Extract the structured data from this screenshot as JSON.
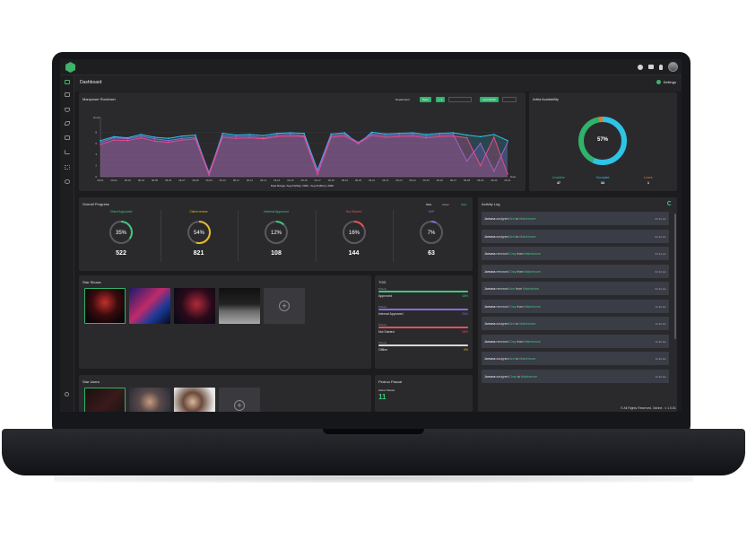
{
  "app": {
    "page_title": "Dashboard",
    "settings_label": "Settings",
    "footer": "© All Rights Reserved. 3dvine - v 1.0.81"
  },
  "icons": {
    "logo": "cube-logo-icon",
    "top": [
      "clock-icon",
      "list-icon",
      "bell-icon",
      "user-avatar"
    ],
    "sidebar": [
      "home-icon",
      "monitor-icon",
      "shield-icon",
      "leaf-icon",
      "calendar-icon",
      "chart-icon",
      "grid-icon",
      "users-icon",
      "settings-icon"
    ]
  },
  "colors": {
    "accent": "#2fb36b",
    "cyan": "#2ec4e6",
    "pink": "#e84a8c",
    "purple": "#8a6cd6",
    "green": "#3fc97a",
    "yellow": "#e6b92e",
    "orange": "#e57a2e",
    "red": "#e0525b"
  },
  "manpower": {
    "title": "Manpower Rundown",
    "department_label": "Department",
    "filter_chip_1": "Paint",
    "filter_chip_2": "+ 2",
    "period_chip": "Last Month",
    "date_range": "Date Range: Aug 01(Sat), 2020 - Aug 31(Mon), 2020",
    "chart_data": {
      "type": "line",
      "ylabel": "Hours",
      "xlabel": "Date",
      "ylim": [
        0,
        10
      ],
      "yticks": [
        0,
        2,
        4,
        6,
        8
      ],
      "categories": [
        "08-01",
        "08-02",
        "08-03",
        "08-04",
        "08-05",
        "08-06",
        "08-07",
        "08-08",
        "08-09",
        "08-10",
        "08-11",
        "08-12",
        "08-13",
        "08-14",
        "08-15",
        "08-16",
        "08-17",
        "08-18",
        "08-19",
        "08-20",
        "08-21",
        "08-22",
        "08-23",
        "08-24",
        "08-25",
        "08-26",
        "08-27",
        "08-28",
        "08-29",
        "08-30",
        "08-31"
      ],
      "series": [
        {
          "values": [
            6.5,
            7.2,
            7.0,
            7.6,
            7.1,
            6.9,
            7.3,
            7.5,
            0.5,
            7.8,
            7.5,
            7.6,
            7.4,
            7.8,
            7.9,
            7.8,
            1.2,
            7.7,
            7.9,
            5.9,
            8.0,
            7.7,
            7.8,
            7.9,
            7.6,
            7.8,
            7.9,
            7.5,
            7.2,
            7.6,
            6.5
          ]
        },
        {
          "values": [
            6.2,
            7.0,
            6.8,
            7.3,
            6.8,
            6.5,
            6.9,
            7.1,
            0.8,
            7.4,
            7.2,
            7.3,
            7.0,
            7.5,
            7.6,
            7.4,
            1.0,
            7.4,
            7.6,
            6.2,
            7.7,
            7.4,
            7.5,
            7.6,
            7.3,
            7.5,
            7.6,
            2.8,
            6.0,
            1.0,
            6.2
          ]
        },
        {
          "values": [
            5.8,
            6.6,
            6.5,
            7.0,
            6.4,
            6.2,
            6.6,
            6.8,
            0.3,
            7.1,
            6.9,
            7.0,
            6.8,
            7.2,
            7.3,
            7.2,
            0.4,
            7.1,
            7.3,
            6.0,
            7.4,
            7.1,
            7.2,
            7.3,
            7.0,
            7.2,
            7.3,
            7.0,
            2.0,
            7.1,
            0.5
          ]
        }
      ]
    }
  },
  "availability": {
    "title": "Artist Availability",
    "center": "57%",
    "donut_segments": [
      {
        "value": 57,
        "color": "#2ec4e6"
      },
      {
        "value": 40,
        "color": "#2fb36b"
      },
      {
        "value": 3,
        "color": "#e57a2e"
      }
    ],
    "stats": [
      {
        "label": "Available",
        "value": "47",
        "color": "#2fb36b"
      },
      {
        "label": "Occupied",
        "value": "34",
        "color": "#2ec4e6"
      },
      {
        "label": "Leave",
        "value": "1",
        "color": "#e57a2e"
      }
    ]
  },
  "progress": {
    "title": "Overall Progress",
    "tabs": [
      "Shot",
      "Asset",
      "Task"
    ],
    "items": [
      {
        "label": "Client Approved",
        "pct_label": "35%",
        "pct": 35,
        "count": "522",
        "color": "#3fc97a"
      },
      {
        "label": "Client review",
        "pct_label": "54%",
        "pct": 54,
        "count": "821",
        "color": "#e6b92e"
      },
      {
        "label": "Internal Approved",
        "pct_label": "12%",
        "pct": 12,
        "count": "108",
        "color": "#3fc97a"
      },
      {
        "label": "Not Started",
        "pct_label": "16%",
        "pct": 16,
        "count": "144",
        "color": "#e0525b"
      },
      {
        "label": "WIP",
        "pct_label": "7%",
        "pct": 7,
        "count": "63",
        "color": "#8a6cd6"
      }
    ]
  },
  "star_shows": {
    "title": "Star Shows"
  },
  "star_users": {
    "title": "Star Users"
  },
  "tod": {
    "title": "TOD",
    "rows": [
      {
        "sub": "8 Done",
        "name": "Approved",
        "pct_label": "16%",
        "pct": 100,
        "color": "#3fc97a"
      },
      {
        "sub": "8 Done",
        "name": "Internal Approved",
        "pct_label": "24%",
        "pct": 100,
        "color": "#8a6cd6"
      },
      {
        "sub": "8 Done",
        "name": "Not Started",
        "pct_label": "16%",
        "pct": 100,
        "color": "#e0525b"
      },
      {
        "sub": "8 Done",
        "name": "Offline",
        "pct_label": "0%",
        "pct": 100,
        "color": "#d8d8d8"
      }
    ]
  },
  "user_card": {
    "name": "Pedroo Pascal",
    "active_label": "Active Shows",
    "active_value": "11"
  },
  "activity": {
    "title": "Activity Log",
    "entries": [
      {
        "actor": "Jamuna",
        "verb": "assigned",
        "target": "Ann",
        "prep": "to",
        "obj": "Matchmove",
        "time": "01:24 pm"
      },
      {
        "actor": "Jamuna",
        "verb": "assigned",
        "target": "Ann",
        "prep": "to",
        "obj": "Matchmove",
        "time": "01:24 pm"
      },
      {
        "actor": "Jamuna",
        "verb": "removed",
        "target": "Gray",
        "prep": "from",
        "obj": "Matchmove",
        "time": "01:24 pm"
      },
      {
        "actor": "Jamuna",
        "verb": "removed",
        "target": "Gray",
        "prep": "from",
        "obj": "Matchmove",
        "time": "01:24 pm"
      },
      {
        "actor": "Jamuna",
        "verb": "removed",
        "target": "Ann",
        "prep": "from",
        "obj": "Matchmove",
        "time": "01:24 pm"
      },
      {
        "actor": "Jamuna",
        "verb": "removed",
        "target": "Gray",
        "prep": "from",
        "obj": "Matchmove",
        "time": "11:26 am"
      },
      {
        "actor": "Jamuna",
        "verb": "assigned",
        "target": "Ann",
        "prep": "to",
        "obj": "Matchmove",
        "time": "11:26 am"
      },
      {
        "actor": "Jamuna",
        "verb": "removed",
        "target": "Gray",
        "prep": "from",
        "obj": "Matchmove",
        "time": "11:26 am"
      },
      {
        "actor": "Jamuna",
        "verb": "assigned",
        "target": "Ann",
        "prep": "to",
        "obj": "Matchmove",
        "time": "11:26 am"
      },
      {
        "actor": "Jamuna",
        "verb": "assigned",
        "target": "Gray",
        "prep": "to",
        "obj": "Matchmove",
        "time": "11:26 am"
      }
    ]
  }
}
